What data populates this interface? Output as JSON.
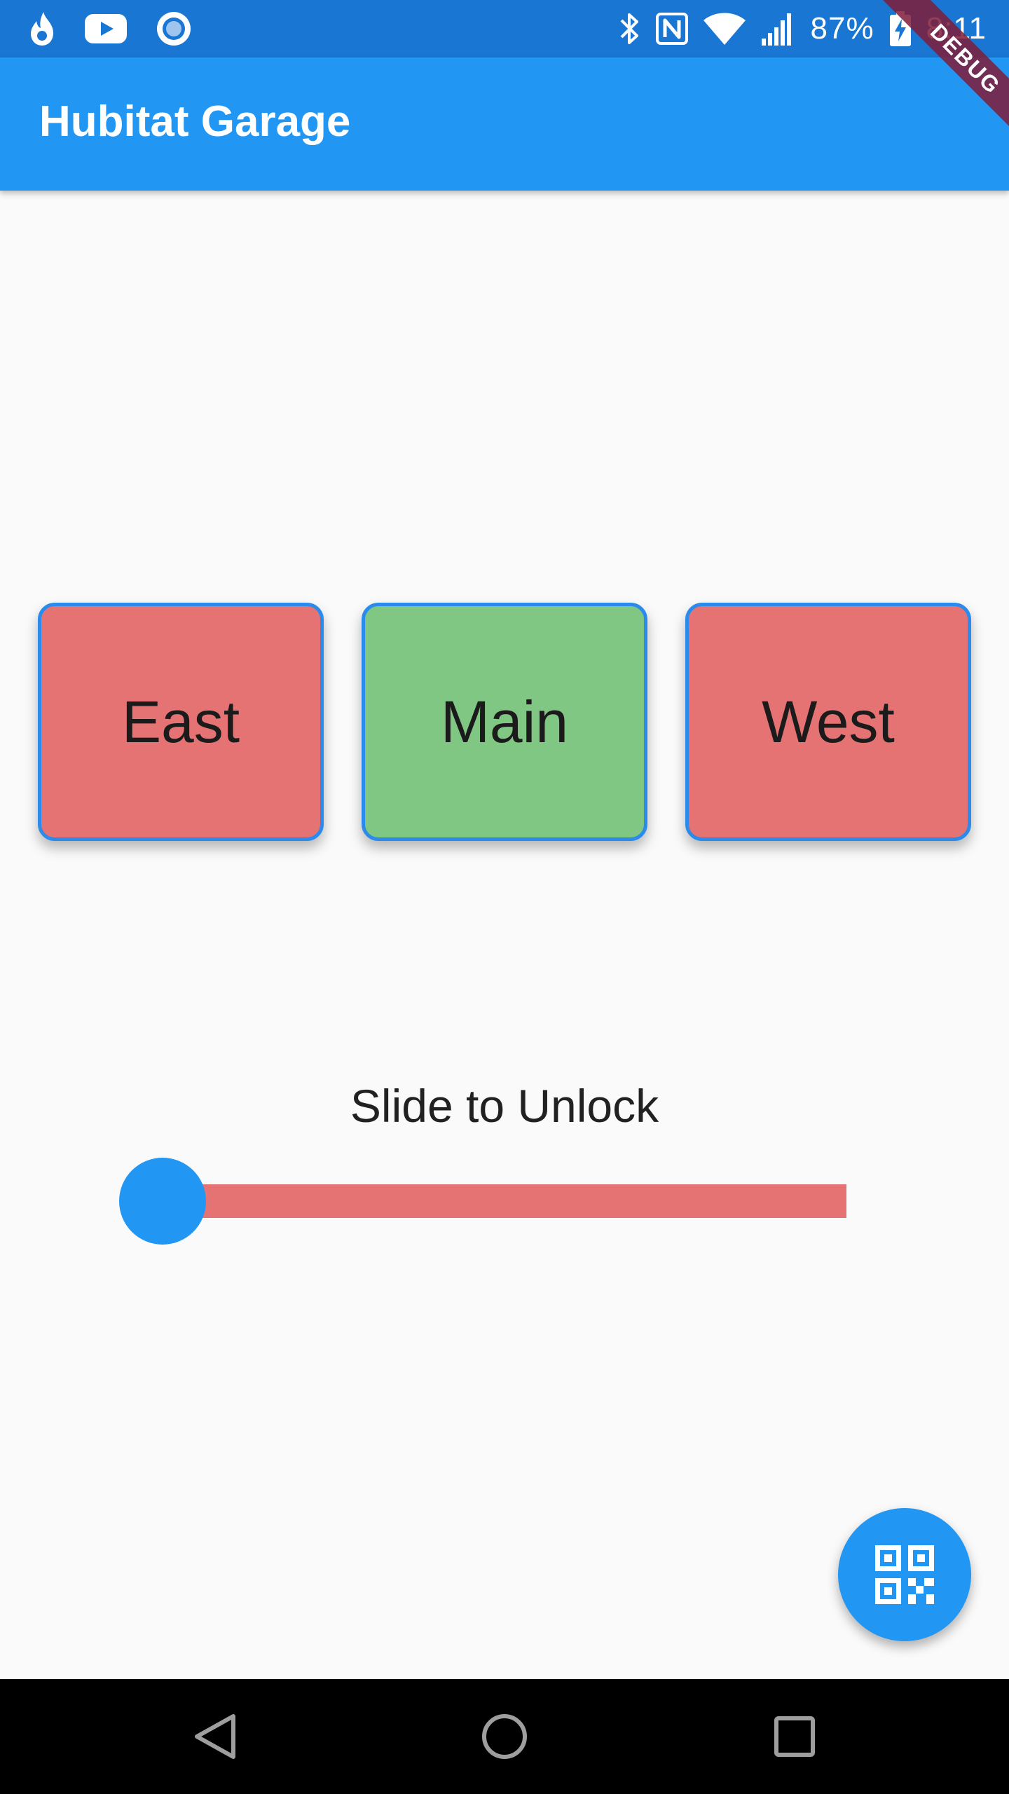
{
  "status_bar": {
    "battery_percent": "87%",
    "time": "8:11",
    "left_icons": [
      "flame-icon",
      "youtube-icon",
      "record-icon"
    ],
    "right_icons": [
      "bluetooth-icon",
      "nfc-icon",
      "wifi-icon",
      "cell-signal-icon",
      "battery-charging-icon"
    ]
  },
  "debug_banner": "DEBUG",
  "app_bar": {
    "title": "Hubitat Garage"
  },
  "doors": [
    {
      "label": "East",
      "state": "closed",
      "color": "#e57373"
    },
    {
      "label": "Main",
      "state": "open",
      "color": "#81c784"
    },
    {
      "label": "West",
      "state": "closed",
      "color": "#e57373"
    }
  ],
  "slider": {
    "caption": "Slide to Unlock",
    "value": 0,
    "thumb_color": "#2196f3",
    "track_color": "#e57373"
  },
  "fab": {
    "icon": "qr-code-icon",
    "color": "#2196f3"
  },
  "nav_bar": {
    "buttons": [
      "back-icon",
      "home-icon",
      "recents-icon"
    ]
  },
  "colors": {
    "primary": "#2196f3",
    "primary_dark": "#1976d2",
    "background": "#fafafa"
  }
}
